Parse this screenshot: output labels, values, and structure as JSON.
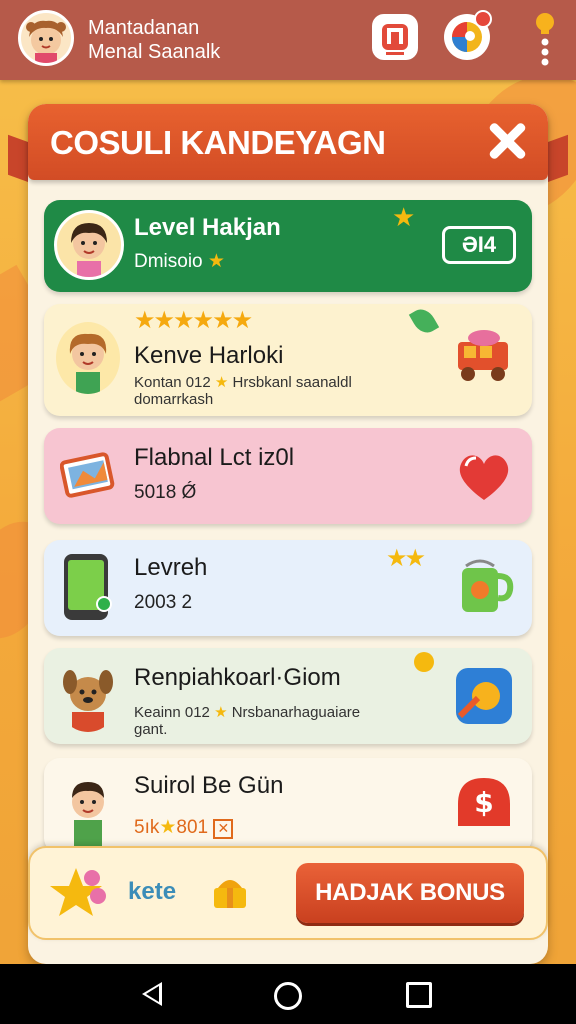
{
  "header": {
    "title_line1": "Mantadanan",
    "title_line2": "Menal Saanalk"
  },
  "panel": {
    "title": "COSULI KANDEYAGN"
  },
  "cards": [
    {
      "title": "Level Hakjan",
      "sub": "Dmisoio",
      "badge": "ƏI4"
    },
    {
      "title": "Kenve Harloki",
      "desc1": "Kontan 012",
      "desc1b": "Hrsbkanl saanaldl",
      "desc2": "domarrkash"
    },
    {
      "title": "Flabnal Lct iz0l",
      "sub": "5018 Ǿ"
    },
    {
      "title": "Levreh",
      "sub": "2003 2"
    },
    {
      "title": "Renpiahkoarl·Giom",
      "desc1": "Keainn 012",
      "desc1b": "Nrsbanarhaguaiare",
      "desc2": "gant."
    },
    {
      "title": "Suirol Be Gün",
      "sub": "5ık",
      "sub2": "801"
    }
  ],
  "footer": {
    "kete": "kete",
    "bonus_button": "HADJAK BONUS"
  },
  "colors": {
    "header_bg": "#b65a4a",
    "panel_head": "#d24c25",
    "accent_green": "#1f8a46"
  },
  "icons": [
    "music-app-icon",
    "game-ball-icon",
    "lightbulb-menu-icon",
    "close-icon",
    "star-icon",
    "heart-icon",
    "phone-icon",
    "mug-icon",
    "dollar-icon",
    "back-icon",
    "home-icon",
    "recent-apps-icon"
  ]
}
